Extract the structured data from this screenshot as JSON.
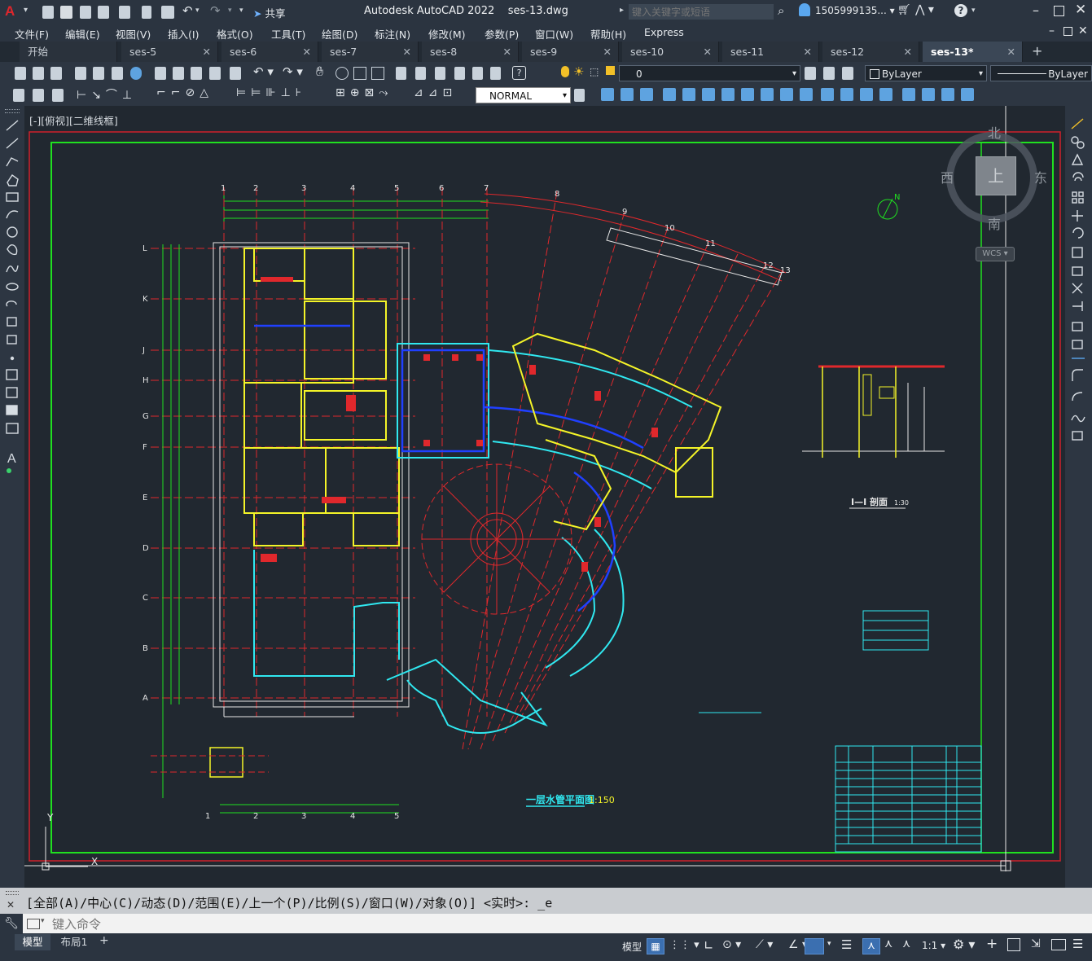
{
  "app": {
    "title": "Autodesk AutoCAD 2022",
    "file": "ses-13.dwg",
    "share_label": "共享",
    "search_placeholder": "键入关键字或短语",
    "user": "1505999135...",
    "help_icon": "help-icon"
  },
  "menu": [
    "文件(F)",
    "编辑(E)",
    "视图(V)",
    "插入(I)",
    "格式(O)",
    "工具(T)",
    "绘图(D)",
    "标注(N)",
    "修改(M)",
    "参数(P)",
    "窗口(W)",
    "帮助(H)",
    "Express"
  ],
  "tabs": [
    {
      "label": "开始",
      "active": false,
      "closable": false
    },
    {
      "label": "ses-5",
      "active": false,
      "closable": true
    },
    {
      "label": "ses-6",
      "active": false,
      "closable": true
    },
    {
      "label": "ses-7",
      "active": false,
      "closable": true
    },
    {
      "label": "ses-8",
      "active": false,
      "closable": true
    },
    {
      "label": "ses-9",
      "active": false,
      "closable": true
    },
    {
      "label": "ses-10",
      "active": false,
      "closable": true
    },
    {
      "label": "ses-11",
      "active": false,
      "closable": true
    },
    {
      "label": "ses-12",
      "active": false,
      "closable": true
    },
    {
      "label": "ses-13*",
      "active": true,
      "closable": true
    }
  ],
  "toolbar": {
    "layer_value": "0",
    "color_value": "ByLayer",
    "linetype_value": "ByLayer",
    "annoscale_value": "NORMAL"
  },
  "viewport": {
    "label": "[-][俯视][二维线框]",
    "compass": {
      "n": "北",
      "s": "南",
      "e": "东",
      "w": "西",
      "top": "上",
      "wcs": "WCS"
    }
  },
  "drawing": {
    "plan_title": "一层水管平面图",
    "plan_scale": "1:150",
    "section_title": "I—I  剖面",
    "section_scale": "1:30",
    "grid_cols": [
      "1",
      "2",
      "3",
      "4",
      "5",
      "6",
      "7",
      "8",
      "9",
      "10",
      "11",
      "12",
      "13"
    ],
    "grid_rows": [
      "L",
      "K",
      "J",
      "H",
      "G",
      "F",
      "E",
      "D",
      "C",
      "B",
      "A"
    ],
    "bottom_cols": [
      "1",
      "2",
      "3",
      "4",
      "5"
    ]
  },
  "command": {
    "history": "[全部(A)/中心(C)/动态(D)/范围(E)/上一个(P)/比例(S)/窗口(W)/对象(O)] <实时>: _e",
    "placeholder": "键入命令"
  },
  "status": {
    "layout_tabs": [
      "模型",
      "布局1"
    ],
    "model_label": "模型",
    "scale": "1:1"
  },
  "colors": {
    "accent": "#3b7fd0",
    "cad_bg": "#212830",
    "border_red": "#d0202a",
    "border_green": "#20e020",
    "line_yellow": "#f4f428",
    "line_cyan": "#30e8f0",
    "line_red": "#e0282c",
    "line_blue": "#2040ff"
  }
}
